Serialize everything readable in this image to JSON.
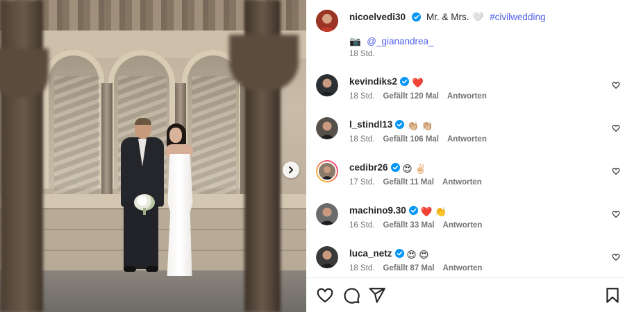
{
  "post": {
    "author": "nicoelvedi30",
    "caption_text": "Mr. & Mrs.",
    "caption_emoji": "🤍",
    "hashtag": "#civilwedding",
    "credit_emoji": "📷",
    "credit_mention": "@_gianandrea_",
    "time": "18 Std."
  },
  "photo": {
    "alt_icon_name": "carousel-next-icon"
  },
  "comments": [
    {
      "username": "kevindiks2",
      "text": "❤️",
      "time": "18 Std.",
      "likes": "Gefällt 120 Mal",
      "reply": "Antworten",
      "avatar_color": "#2c2f33"
    },
    {
      "username": "l_stindl13",
      "text": "👏🏼 👏🏼",
      "time": "18 Std.",
      "likes": "Gefällt 106 Mal",
      "reply": "Antworten",
      "avatar_color": "#55504a"
    },
    {
      "username": "cedibr26",
      "text": "😍 ✌🏻",
      "time": "17 Std.",
      "likes": "Gefällt 11 Mal",
      "reply": "Antworten",
      "avatar_color": "#8a7a6a"
    },
    {
      "username": "machino9.30",
      "text": "❤️ 👏",
      "time": "16 Std.",
      "likes": "Gefällt 33 Mal",
      "reply": "Antworten",
      "avatar_color": "#6b6b6b"
    },
    {
      "username": "luca_netz",
      "text": "😍 😍",
      "time": "18 Std.",
      "likes": "Gefällt 87 Mal",
      "reply": "Antworten",
      "avatar_color": "#3a3a3a"
    }
  ],
  "colors": {
    "verified": "#0095f6",
    "hashtag": "#4d5ee8",
    "story_ring_start": "#f9ce34",
    "story_ring_end": "#ee2a7b"
  },
  "actions": {
    "like": "heart-icon",
    "comment": "comment-icon",
    "share": "share-icon",
    "save": "bookmark-icon"
  }
}
